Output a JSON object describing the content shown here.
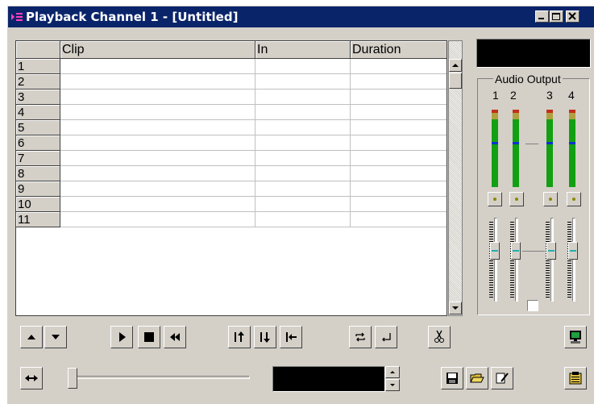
{
  "window": {
    "title": "Playback Channel 1 - [Untitled]",
    "titlebar_color": "#0a246a"
  },
  "grid": {
    "columns": [
      "Clip",
      "In",
      "Duration"
    ],
    "rows": [
      {
        "num": "1",
        "clip": "",
        "in": "",
        "duration": ""
      },
      {
        "num": "2",
        "clip": "",
        "in": "",
        "duration": ""
      },
      {
        "num": "3",
        "clip": "",
        "in": "",
        "duration": ""
      },
      {
        "num": "4",
        "clip": "",
        "in": "",
        "duration": ""
      },
      {
        "num": "5",
        "clip": "",
        "in": "",
        "duration": ""
      },
      {
        "num": "6",
        "clip": "",
        "in": "",
        "duration": ""
      },
      {
        "num": "7",
        "clip": "",
        "in": "",
        "duration": ""
      },
      {
        "num": "8",
        "clip": "",
        "in": "",
        "duration": ""
      },
      {
        "num": "9",
        "clip": "",
        "in": "",
        "duration": ""
      },
      {
        "num": "10",
        "clip": "",
        "in": "",
        "duration": ""
      },
      {
        "num": "11",
        "clip": "",
        "in": "",
        "duration": ""
      }
    ]
  },
  "audio": {
    "title": "Audio Output",
    "channels": [
      "1",
      "2",
      "3",
      "4"
    ],
    "meter_colors": {
      "green": "#12a012",
      "red": "#c0301c",
      "yellow": "#b0a040",
      "blue": "#1030d0"
    }
  },
  "toolbar": {
    "icons": [
      "move-up-icon",
      "move-down-icon",
      "play-icon",
      "stop-icon",
      "rewind-icon",
      "insert-before-icon",
      "insert-after-icon",
      "go-to-start-icon",
      "loop-icon",
      "return-icon",
      "cut-icon",
      "monitor-icon",
      "expand-icon",
      "save-icon",
      "open-folder-icon",
      "edit-icon",
      "clipboard-icon"
    ]
  },
  "timecode": {
    "value": ""
  }
}
